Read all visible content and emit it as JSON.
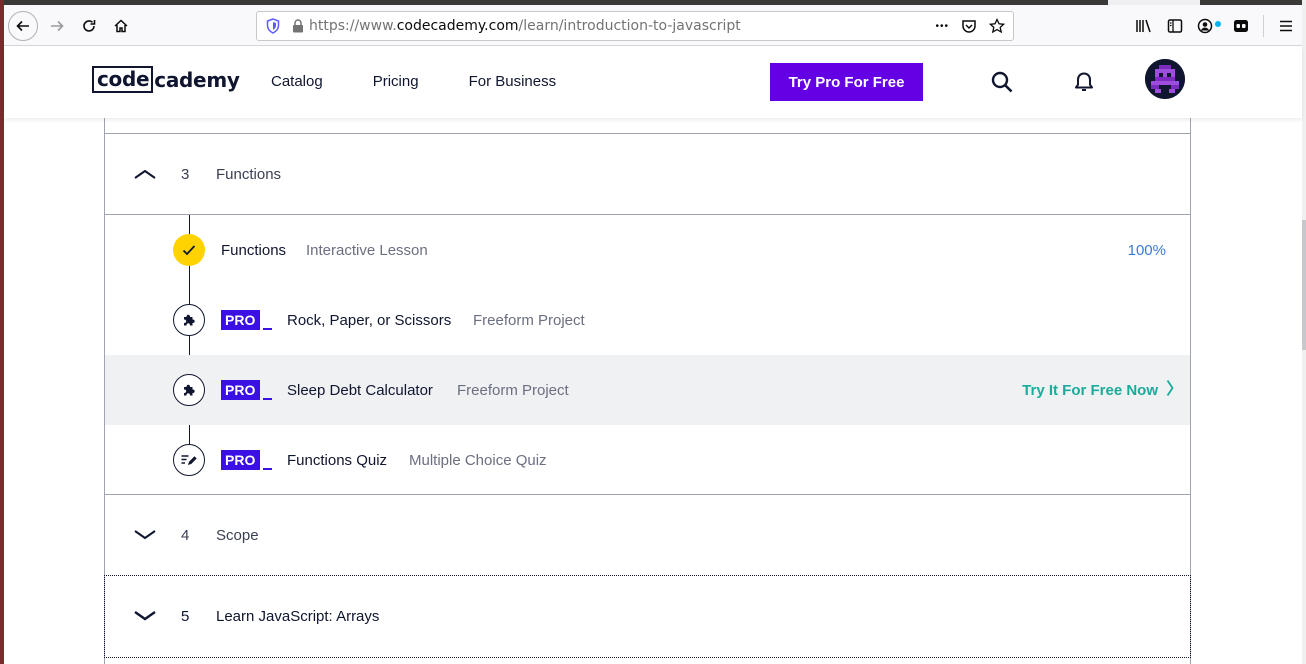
{
  "browser": {
    "url_prefix": "https://www.",
    "url_host": "codecademy.com",
    "url_path": "/learn/introduction-to-javascript",
    "url_menu_glyph": "•••"
  },
  "header": {
    "logo_boxed": "code",
    "logo_rest": "cademy",
    "nav": [
      {
        "label": "Catalog"
      },
      {
        "label": "Pricing"
      },
      {
        "label": "For Business"
      }
    ],
    "try_pro_label": "Try Pro For Free"
  },
  "modules": [
    {
      "number": "3",
      "title": "Functions",
      "expanded": true
    },
    {
      "number": "4",
      "title": "Scope",
      "expanded": false
    },
    {
      "number": "5",
      "title": "Learn JavaScript: Arrays",
      "expanded": false
    }
  ],
  "lessons": [
    {
      "title": "Functions",
      "type": "Interactive Lesson",
      "status": "completed",
      "progress_text": "100%",
      "pro": false
    },
    {
      "title": "Rock, Paper, or Scissors",
      "type": "Freeform Project",
      "status": "locked",
      "pro": true
    },
    {
      "title": "Sleep Debt Calculator",
      "type": "Freeform Project",
      "status": "locked",
      "pro": true,
      "cta": "Try It For Free Now"
    },
    {
      "title": "Functions Quiz",
      "type": "Multiple Choice Quiz",
      "status": "locked",
      "pro": true
    }
  ],
  "pro_label": "PRO",
  "icons": {
    "back": "arrow-left-icon",
    "forward": "arrow-right-icon",
    "reload": "reload-icon",
    "home": "home-icon",
    "search": "search-icon",
    "bell": "bell-icon",
    "puzzle": "puzzle-icon",
    "quiz": "quiz-pencil-icon",
    "check": "check-icon"
  },
  "colors": {
    "brand_purple": "#6400e4",
    "pro_blue": "#3a10e5",
    "check_yellow": "#ffd300",
    "percent_blue": "#3a7bd5",
    "cta_teal": "#1aab9b",
    "navy": "#10162f"
  }
}
